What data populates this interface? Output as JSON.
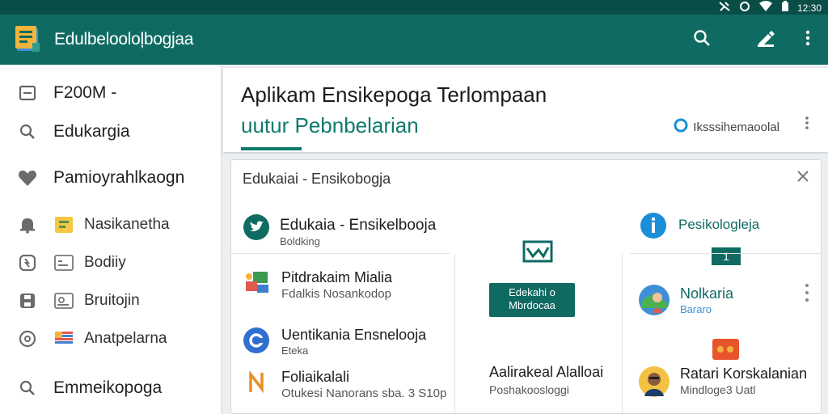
{
  "status_bar": {
    "time": "12:30"
  },
  "app_bar": {
    "title": "Edulbelooloļbogjaa",
    "brand_color": "#0f6b62",
    "actions": [
      "search-icon",
      "edit-icon",
      "more-vert-icon"
    ]
  },
  "sidebar": {
    "items": [
      {
        "label": "F200M -",
        "icon": "inbox-icon"
      },
      {
        "label": "Edukargia",
        "icon": "search-icon"
      },
      {
        "label": "Pamioyrahlkaogn",
        "icon": "heart-icon"
      },
      {
        "label": "Nasikanetha",
        "icon": "bell-icon"
      },
      {
        "label": "Bodiiy",
        "icon": "refresh-icon"
      },
      {
        "label": "Bruitojin",
        "icon": "save-icon"
      },
      {
        "label": "Anatpelarna",
        "icon": "help-icon"
      },
      {
        "label": "Emmeikopoga",
        "icon": "search-icon"
      }
    ]
  },
  "header": {
    "title": "Aplikam Ensikepoga Terlompaan",
    "subtitle": "uutur Pebnbelarian",
    "link_label": "Iksssihemaoolal"
  },
  "panel": {
    "title": "Edukaiai - Ensikobogja",
    "featured": {
      "title": "Edukaia - Ensikelbooja",
      "subtitle": "Boldking"
    },
    "right_header": "Pesikologleja",
    "count_badge": "1",
    "center_button": "Edekahi o Mbrdocaa",
    "left_items": [
      {
        "title": "Pitdrakaim Mialia",
        "subtitle": "Fdalkis Nosankodop"
      },
      {
        "title": "Uentikania Ensnelooja",
        "subtitle": "Eteka"
      },
      {
        "title": "Foliaikalali",
        "subtitle": "Otukesi Nanorans sba. 3 S10p"
      }
    ],
    "center_item": {
      "title": "Aalirakeal Alalloai",
      "subtitle": "Poshakoosloggi"
    },
    "right_items": [
      {
        "title": "Nolkaria",
        "subtitle": "Bararo"
      },
      {
        "title": "Ratari Korskalanian",
        "subtitle": "Mindloge3 Uatl"
      }
    ]
  }
}
